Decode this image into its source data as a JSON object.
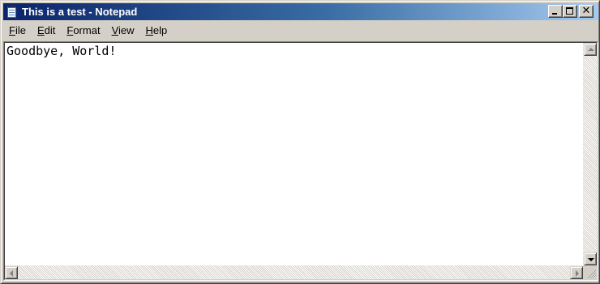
{
  "window": {
    "title": "This is a test - Notepad",
    "app_icon": "notepad-icon",
    "buttons": {
      "minimize": "minimize-icon",
      "maximize": "maximize-icon",
      "close": "close-icon",
      "close_glyph": "✕"
    }
  },
  "menu": {
    "items": [
      {
        "label_underlined": "F",
        "label_rest": "ile"
      },
      {
        "label_underlined": "E",
        "label_rest": "dit"
      },
      {
        "label_underlined": "F",
        "label_rest": "ormat"
      },
      {
        "label_underlined": "V",
        "label_rest": "iew"
      },
      {
        "label_underlined": "H",
        "label_rest": "elp"
      }
    ]
  },
  "editor": {
    "content": "Goodbye, World!"
  },
  "colors": {
    "title_active_start": "#0a246a",
    "title_active_end": "#a6caf0",
    "face": "#d4d0c8"
  }
}
